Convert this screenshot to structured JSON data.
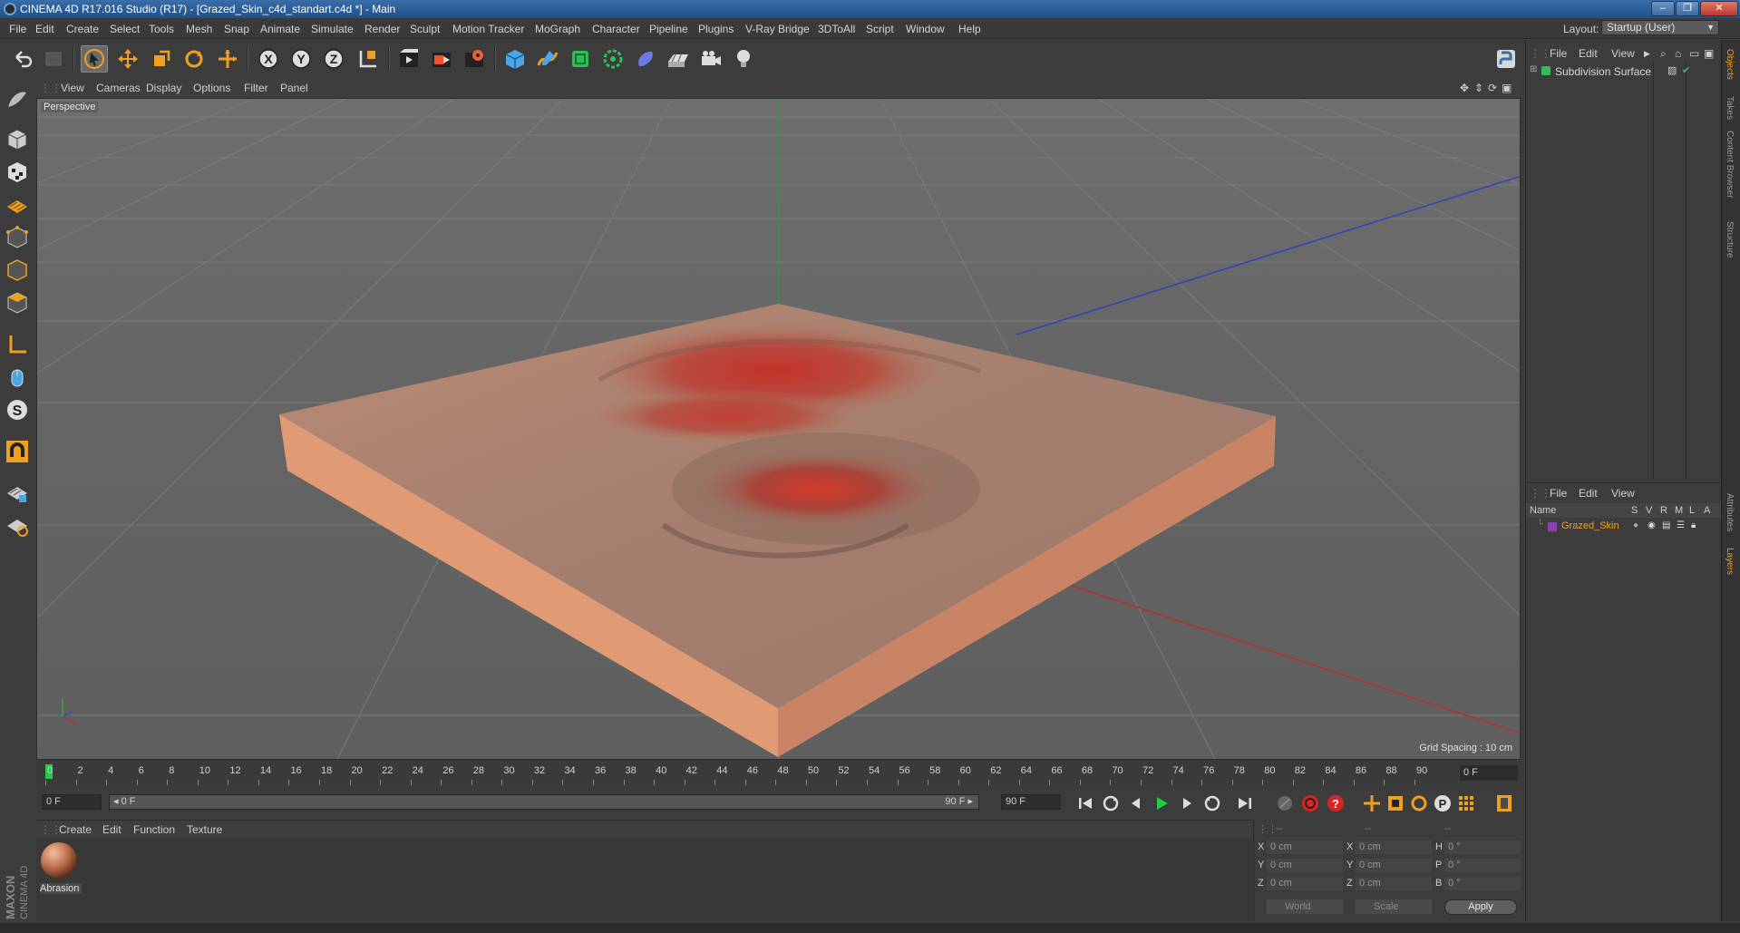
{
  "window": {
    "title": "CINEMA 4D R17.016 Studio (R17) - [Grazed_Skin_c4d_standart.c4d *] - Main",
    "minimize": "–",
    "maximize": "❐",
    "close": "✕"
  },
  "menubar": {
    "items": [
      "File",
      "Edit",
      "Create",
      "Select",
      "Tools",
      "Mesh",
      "Snap",
      "Animate",
      "Simulate",
      "Render",
      "Sculpt",
      "Motion Tracker",
      "MoGraph",
      "Character",
      "Pipeline",
      "Plugins",
      "V-Ray Bridge",
      "3DToAll",
      "Script",
      "Window",
      "Help"
    ],
    "layout_label": "Layout:",
    "layout_value": "Startup (User)"
  },
  "toolbar": {
    "icons": [
      "undo-icon",
      "redo-icon",
      "selection-arrow-icon",
      "move-icon",
      "scale-icon",
      "rotate-icon",
      "live-selection-icon",
      "x-axis-lock-icon",
      "y-axis-lock-icon",
      "z-axis-lock-icon",
      "world-coordinates-icon",
      "render-view-icon",
      "render-picture-viewer-icon",
      "render-settings-icon",
      "cube-primitive-icon",
      "pen-spline-icon",
      "subdivision-surface-icon",
      "array-cloner-icon",
      "deformer-icon",
      "floor-scene-icon",
      "camera-icon",
      "light-icon",
      "python-icon"
    ]
  },
  "viewport": {
    "menu": [
      "View",
      "Cameras",
      "Display",
      "Options",
      "Filter",
      "Panel"
    ],
    "label": "Perspective",
    "grid_spacing": "Grid Spacing : 10 cm"
  },
  "timeline": {
    "ticks": [
      "0",
      "2",
      "4",
      "6",
      "8",
      "10",
      "12",
      "14",
      "16",
      "18",
      "20",
      "22",
      "24",
      "26",
      "28",
      "30",
      "32",
      "34",
      "36",
      "38",
      "40",
      "42",
      "44",
      "46",
      "48",
      "50",
      "52",
      "54",
      "56",
      "58",
      "60",
      "62",
      "64",
      "66",
      "68",
      "70",
      "72",
      "74",
      "76",
      "78",
      "80",
      "82",
      "84",
      "86",
      "88",
      "90"
    ],
    "current_frame": "0 F"
  },
  "transport": {
    "start_field": "0 F",
    "range_start": "◂ 0 F",
    "range_end": "90 F ▸",
    "end_field": "90 F"
  },
  "material_manager": {
    "menu": [
      "Create",
      "Edit",
      "Function",
      "Texture"
    ],
    "material_name": "Abrasion"
  },
  "coordinates": {
    "header_dashes": [
      "--",
      "--",
      "--"
    ],
    "rows": [
      {
        "a_label": "X",
        "a_value": "0 cm",
        "b_label": "X",
        "b_value": "0 cm",
        "c_label": "H",
        "c_value": "0 °"
      },
      {
        "a_label": "Y",
        "a_value": "0 cm",
        "b_label": "Y",
        "b_value": "0 cm",
        "c_label": "P",
        "c_value": "0 °"
      },
      {
        "a_label": "Z",
        "a_value": "0 cm",
        "b_label": "Z",
        "b_value": "0 cm",
        "c_label": "B",
        "c_value": "0 °"
      }
    ],
    "space_select": "World",
    "mode_select": "Scale",
    "apply": "Apply"
  },
  "object_manager": {
    "menu": [
      "File",
      "Edit",
      "View"
    ],
    "objects": [
      {
        "name": "Subdivision Surface"
      }
    ]
  },
  "layer_manager": {
    "menu": [
      "File",
      "Edit",
      "View"
    ],
    "columns": [
      "Name",
      "S",
      "V",
      "R",
      "M",
      "L",
      "A"
    ],
    "layers": [
      {
        "name": "Grazed_Skin",
        "color": "#8a3fb0"
      }
    ]
  },
  "right_tabs": [
    "Objects",
    "Takes",
    "Content Browser",
    "Structure",
    "Attributes",
    "Layers"
  ],
  "brand": {
    "maxon": "MAXON",
    "product": "CINEMA 4D"
  },
  "colors": {
    "accent_orange": "#f0a020",
    "playhead_green": "#22cc44",
    "axis_x": "#c03030",
    "axis_y": "#30a030",
    "axis_z": "#3050c0"
  }
}
